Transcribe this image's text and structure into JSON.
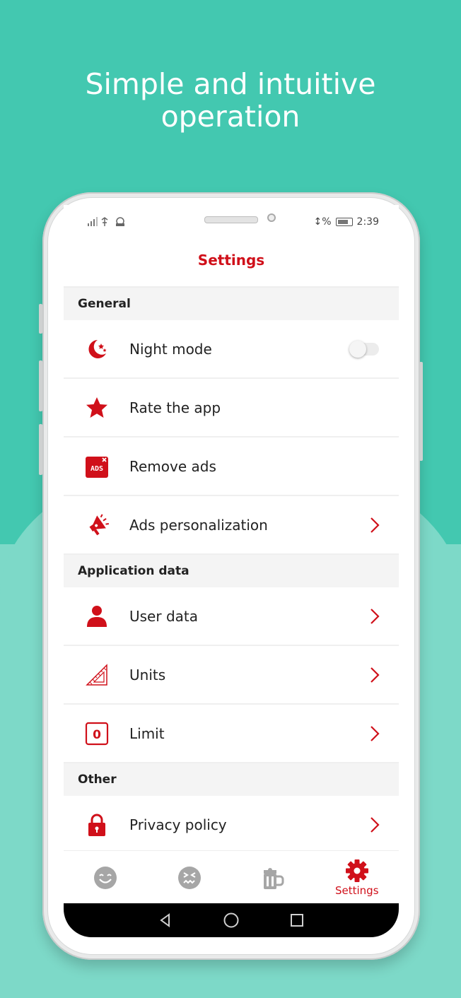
{
  "headline": {
    "line1": "Simple and intuitive",
    "line2": "operation"
  },
  "status_bar": {
    "left": "▎▎▎ Ψ ☃",
    "battery": "↕%",
    "time": "2:39"
  },
  "app": {
    "title": "Settings",
    "accent": "#d0101a"
  },
  "sections": [
    {
      "title": "General",
      "items": [
        {
          "label": "Night mode",
          "icon": "moon-stars-icon",
          "control": "toggle",
          "toggle_on": false
        },
        {
          "label": "Rate the app",
          "icon": "star-icon",
          "control": "none"
        },
        {
          "label": "Remove ads",
          "icon": "ads-icon",
          "icon_text": "ADS",
          "control": "none"
        },
        {
          "label": "Ads personalization",
          "icon": "megaphone-icon",
          "control": "chevron"
        }
      ]
    },
    {
      "title": "Application data",
      "items": [
        {
          "label": "User data",
          "icon": "user-icon",
          "control": "chevron"
        },
        {
          "label": "Units",
          "icon": "ruler-triangle-icon",
          "control": "chevron"
        },
        {
          "label": "Limit",
          "icon": "limit-icon",
          "icon_text": "0",
          "control": "chevron"
        }
      ]
    },
    {
      "title": "Other",
      "items": [
        {
          "label": "Privacy policy",
          "icon": "lock-icon",
          "control": "chevron"
        }
      ]
    }
  ],
  "bottom_nav": [
    {
      "icon": "smile-face-icon",
      "label": "",
      "active": false
    },
    {
      "icon": "sick-face-icon",
      "label": "",
      "active": false
    },
    {
      "icon": "beer-mug-icon",
      "label": "",
      "active": false
    },
    {
      "icon": "gear-icon",
      "label": "Settings",
      "active": true
    }
  ],
  "system_nav": [
    "back-icon",
    "home-icon",
    "recents-icon"
  ]
}
